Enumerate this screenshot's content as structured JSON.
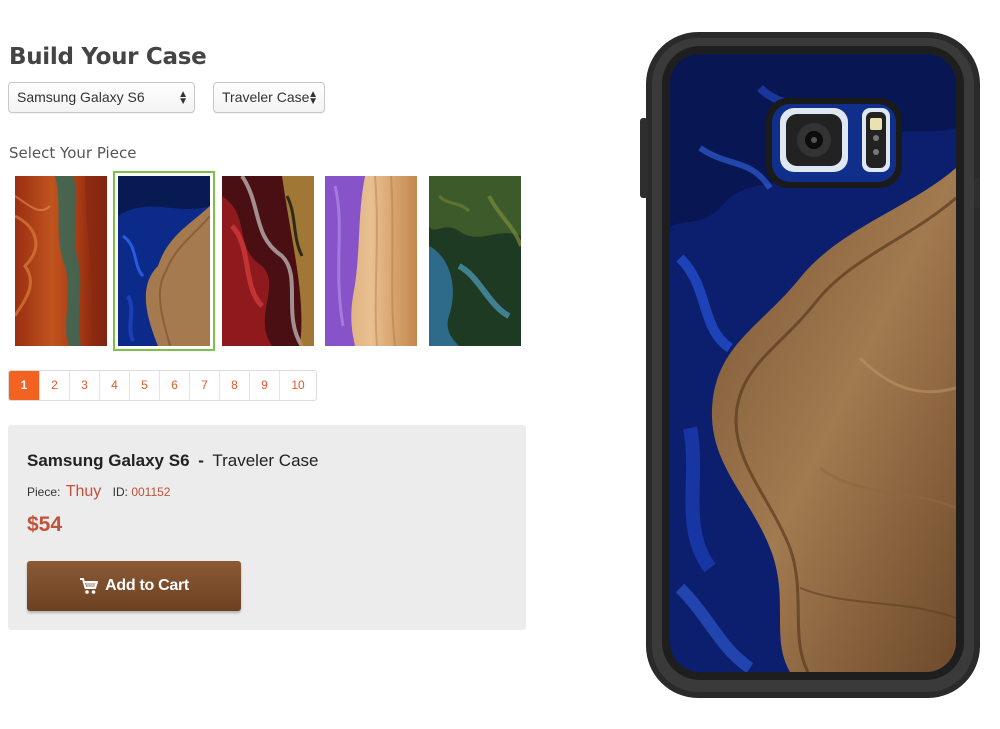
{
  "page_title": "Build Your Case",
  "device_select": {
    "value": "Samsung Galaxy S6"
  },
  "case_select": {
    "value": "Traveler Case"
  },
  "select_piece_label": "Select Your Piece",
  "thumbnails": [
    {
      "name": "red-amber-burl"
    },
    {
      "name": "blue-resin-burl",
      "selected": true
    },
    {
      "name": "red-black-swirl"
    },
    {
      "name": "purple-resin-maple"
    },
    {
      "name": "green-blue-burl"
    }
  ],
  "pagination": {
    "pages": [
      "1",
      "2",
      "3",
      "4",
      "5",
      "6",
      "7",
      "8",
      "9",
      "10"
    ],
    "current": "1"
  },
  "summary": {
    "device": "Samsung Galaxy S6",
    "separator": "-",
    "case_type": "Traveler Case",
    "piece_label": "Piece:",
    "piece_name": "Thuy",
    "id_label": "ID:",
    "id_value": "001152",
    "price": "$54",
    "add_to_cart": "Add to Cart",
    "cart_icon": "shopping-cart-icon"
  },
  "colors": {
    "accent": "#f26322",
    "price": "#c0513a",
    "selected_border": "#7dc14b",
    "cart_button": "#7a4c2b"
  }
}
